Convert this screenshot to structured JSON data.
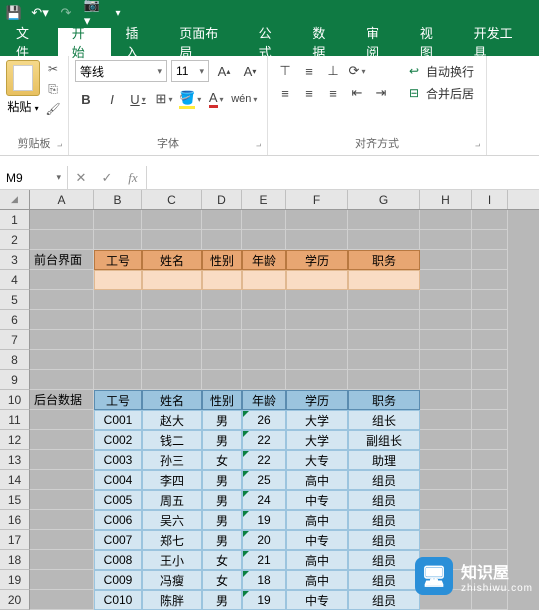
{
  "qat": {
    "save": "save",
    "undo": "undo",
    "redo": "redo",
    "camera": "camera"
  },
  "tabs": {
    "file": "文件",
    "home": "开始",
    "insert": "插入",
    "layout": "页面布局",
    "formulas": "公式",
    "data": "数据",
    "review": "审阅",
    "view": "视图",
    "dev": "开发工具"
  },
  "ribbon": {
    "clipboard": {
      "label": "剪贴板",
      "paste": "粘贴"
    },
    "font": {
      "label": "字体",
      "name": "等线",
      "size": "11",
      "bold": "B",
      "italic": "I",
      "underline": "U",
      "phonetic": "wén"
    },
    "alignment": {
      "label": "对齐方式",
      "wrap": "自动换行",
      "merge": "合并后居"
    }
  },
  "namebox": "M9",
  "formula": "",
  "columns": [
    "A",
    "B",
    "C",
    "D",
    "E",
    "F",
    "G",
    "H",
    "I"
  ],
  "front": {
    "label": "前台界面",
    "headers": [
      "工号",
      "姓名",
      "性别",
      "年龄",
      "学历",
      "职务"
    ]
  },
  "back": {
    "label": "后台数据",
    "headers": [
      "工号",
      "姓名",
      "性别",
      "年龄",
      "学历",
      "职务"
    ],
    "rows": [
      {
        "id": "C001",
        "name": "赵大",
        "sex": "男",
        "age": "26",
        "edu": "大学",
        "job": "组长"
      },
      {
        "id": "C002",
        "name": "钱二",
        "sex": "男",
        "age": "22",
        "edu": "大学",
        "job": "副组长"
      },
      {
        "id": "C003",
        "name": "孙三",
        "sex": "女",
        "age": "22",
        "edu": "大专",
        "job": "助理"
      },
      {
        "id": "C004",
        "name": "李四",
        "sex": "男",
        "age": "25",
        "edu": "高中",
        "job": "组员"
      },
      {
        "id": "C005",
        "name": "周五",
        "sex": "男",
        "age": "24",
        "edu": "中专",
        "job": "组员"
      },
      {
        "id": "C006",
        "name": "吴六",
        "sex": "男",
        "age": "19",
        "edu": "高中",
        "job": "组员"
      },
      {
        "id": "C007",
        "name": "郑七",
        "sex": "男",
        "age": "20",
        "edu": "中专",
        "job": "组员"
      },
      {
        "id": "C008",
        "name": "王小",
        "sex": "女",
        "age": "21",
        "edu": "高中",
        "job": "组员"
      },
      {
        "id": "C009",
        "name": "冯瘦",
        "sex": "女",
        "age": "18",
        "edu": "高中",
        "job": "组员"
      },
      {
        "id": "C010",
        "name": "陈胖",
        "sex": "男",
        "age": "19",
        "edu": "中专",
        "job": "组员"
      }
    ]
  },
  "watermark": {
    "name": "知识屋",
    "url": "zhishiwu.com"
  }
}
